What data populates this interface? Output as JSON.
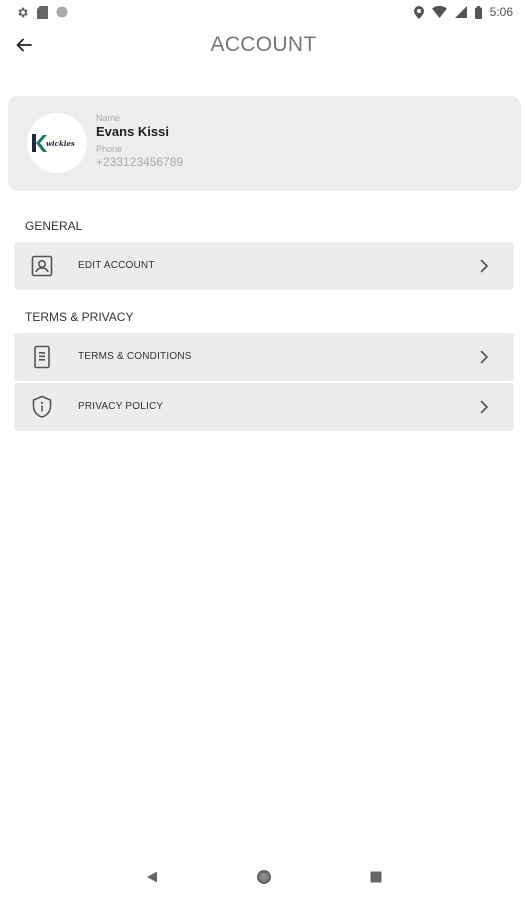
{
  "status_bar": {
    "time": "5:06",
    "left_icons": [
      "gear-icon",
      "sd-card-icon",
      "circle-icon"
    ],
    "right_icons": [
      "location-icon",
      "wifi-icon",
      "signal-icon",
      "battery-icon"
    ]
  },
  "header": {
    "title": "ACCOUNT",
    "back_icon": "arrow-left-icon"
  },
  "profile": {
    "logo_text": "wickles",
    "logo_letter": "K",
    "name_label": "Name",
    "name": "Evans Kissi",
    "phone_label": "Phone",
    "phone": "+233123456789"
  },
  "sections": {
    "general": {
      "title": "GENERAL",
      "items": [
        {
          "label": "EDIT ACCOUNT",
          "icon": "contact-card-icon"
        }
      ]
    },
    "terms": {
      "title": "TERMS & PRIVACY",
      "items": [
        {
          "label": "TERMS & CONDITIONS",
          "icon": "document-icon"
        },
        {
          "label": "PRIVACY POLICY",
          "icon": "shield-info-icon"
        }
      ]
    }
  },
  "nav_bar": {
    "icons": [
      "back-triangle-icon",
      "home-circle-icon",
      "recents-square-icon"
    ]
  },
  "colors": {
    "card_bg": "#ededed",
    "row_bg": "#ececec",
    "logo_teal": "#1b7a6e",
    "logo_dark": "#1c2a3a"
  }
}
